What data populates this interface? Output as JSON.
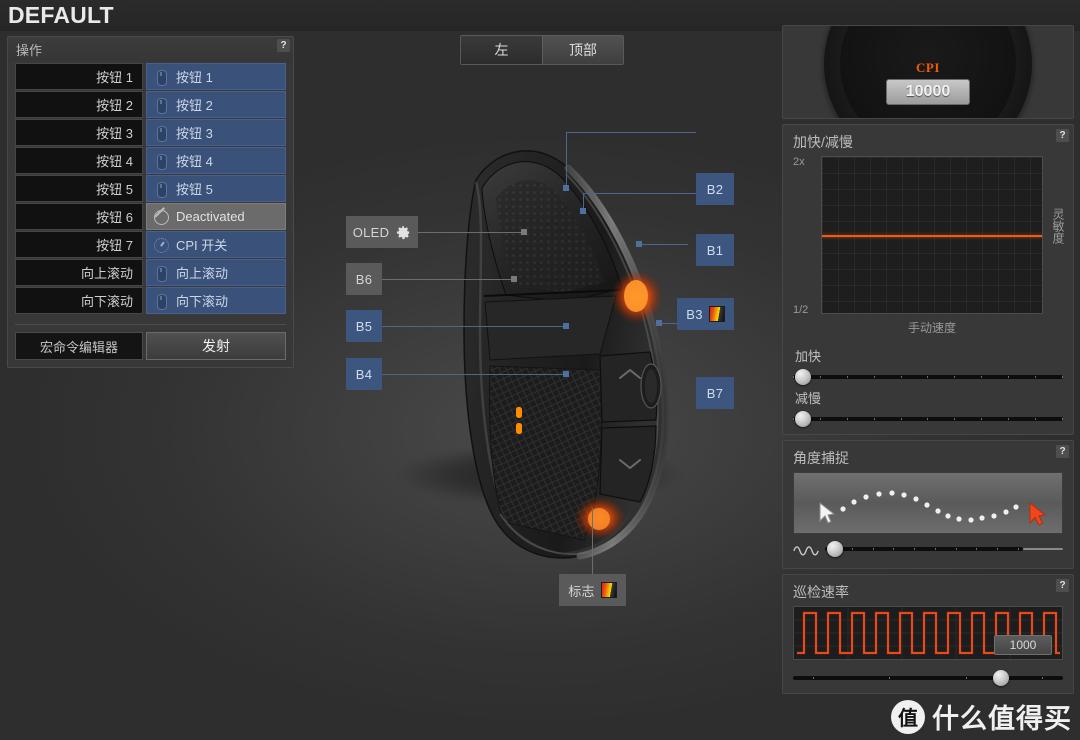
{
  "header": {
    "profile_title": "DEFAULT"
  },
  "left_panel": {
    "title": "操作",
    "help_label": "?",
    "rows": [
      {
        "key": "按钮 1",
        "action": "按钮 1",
        "icon": "mouse-icon",
        "state": "assigned"
      },
      {
        "key": "按钮 2",
        "action": "按钮 2",
        "icon": "mouse-icon",
        "state": "assigned"
      },
      {
        "key": "按钮 3",
        "action": "按钮 3",
        "icon": "mouse-icon",
        "state": "assigned"
      },
      {
        "key": "按钮 4",
        "action": "按钮 4",
        "icon": "mouse-icon",
        "state": "assigned"
      },
      {
        "key": "按钮 5",
        "action": "按钮 5",
        "icon": "mouse-icon",
        "state": "assigned"
      },
      {
        "key": "按钮 6",
        "action": "Deactivated",
        "icon": "ban-icon",
        "state": "deactivated"
      },
      {
        "key": "按钮 7",
        "action": "CPI 开关",
        "icon": "cpi-gauge-icon",
        "state": "assigned"
      },
      {
        "key": "向上滚动",
        "action": "向上滚动",
        "icon": "mouse-icon",
        "state": "assigned"
      },
      {
        "key": "向下滚动",
        "action": "向下滚动",
        "icon": "mouse-icon",
        "state": "assigned"
      }
    ],
    "macro_editor_label": "宏命令编辑器",
    "fire_label": "发射"
  },
  "center": {
    "tabs": [
      {
        "label": "左",
        "selected": true
      },
      {
        "label": "顶部",
        "selected": false
      }
    ],
    "callouts": [
      {
        "id": "B2",
        "label": "B2",
        "style": "blue"
      },
      {
        "id": "B1",
        "label": "B1",
        "style": "blue"
      },
      {
        "id": "B3",
        "label": "B3",
        "style": "blue",
        "swatch": true
      },
      {
        "id": "B7",
        "label": "B7",
        "style": "blue"
      },
      {
        "id": "OLED",
        "label": "OLED",
        "style": "grey",
        "gear": true
      },
      {
        "id": "B6",
        "label": "B6",
        "style": "grey"
      },
      {
        "id": "B5",
        "label": "B5",
        "style": "blue"
      },
      {
        "id": "B4",
        "label": "B4",
        "style": "blue"
      },
      {
        "id": "logo",
        "label": "标志",
        "style": "grey",
        "swatch": true
      }
    ]
  },
  "right_panel": {
    "cpi": {
      "label": "CPI",
      "value": "10000",
      "accent": "#f05a00"
    },
    "acceleration": {
      "title": "加快/减慢",
      "help_label": "?",
      "axis_max": "2x",
      "axis_min": "1/2",
      "x_label": "手动速度",
      "y_label": "灵敏度",
      "accel_slider_label": "加快",
      "decel_slider_label": "减慢",
      "accel_value": 0,
      "decel_value": 0
    },
    "angle_snapping": {
      "title": "角度捕捉",
      "help_label": "?",
      "value": 5
    },
    "polling": {
      "title": "巡检速率",
      "help_label": "?",
      "value": "1000",
      "slider_value": 74
    }
  },
  "chart_data": {
    "type": "line",
    "title": "加快/减慢",
    "xlabel": "手动速度",
    "ylabel": "灵敏度",
    "ylim": [
      0.5,
      2
    ],
    "ytick_labels": [
      "2x",
      "1/2"
    ],
    "series": [
      {
        "name": "sensitivity",
        "x": [
          0,
          1
        ],
        "values": [
          1.0,
          1.0
        ],
        "color": "#f05a14"
      }
    ],
    "grid": true,
    "legend": "none"
  },
  "watermark": {
    "badge": "值",
    "text": "什么值得买"
  }
}
